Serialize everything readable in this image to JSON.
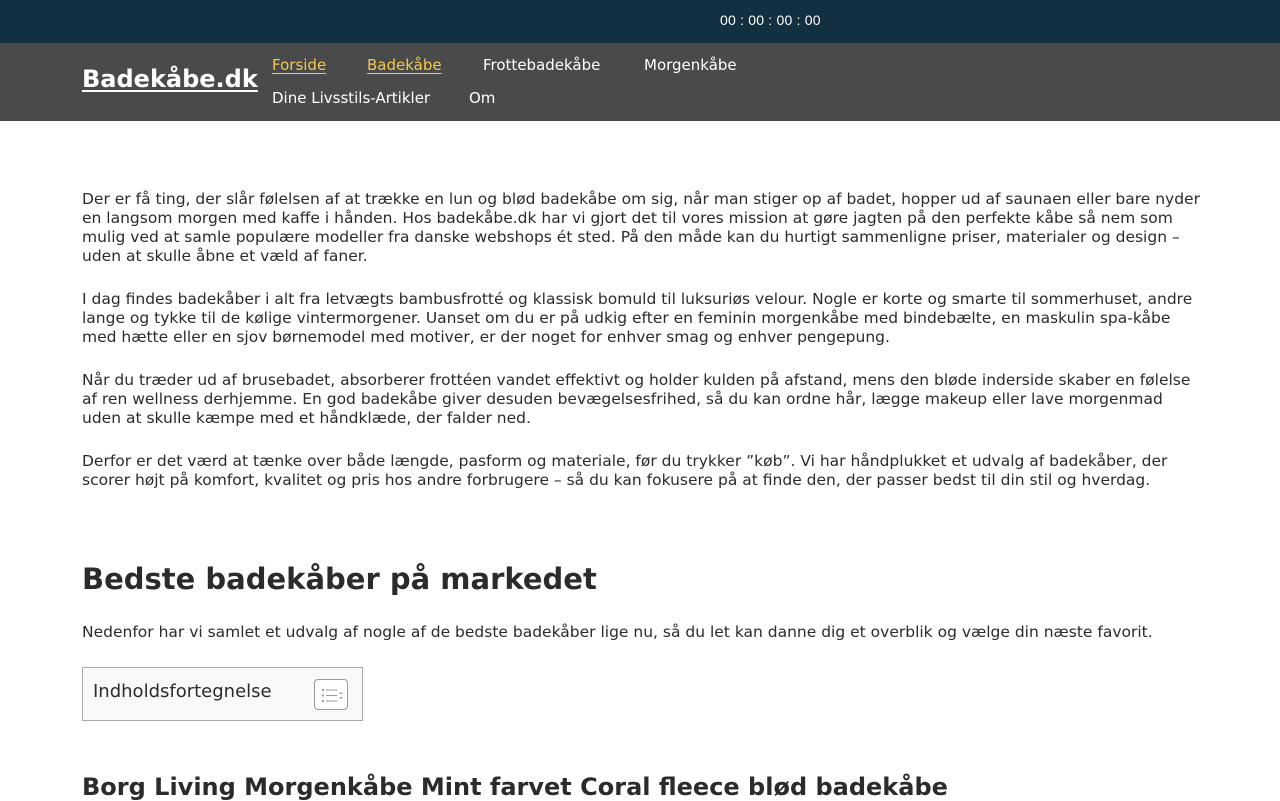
{
  "topbar": {
    "countdown": "00 : 00 : 00 : 00",
    "background": "#12303f"
  },
  "header": {
    "logo": "Badekåbe.dk",
    "background": "#4a4a4a",
    "accent": "#f2c94c",
    "nav": [
      {
        "label": "Forside",
        "active": true
      },
      {
        "label": "Badekåbe",
        "active": true
      },
      {
        "label": "Frottebadekåbe",
        "active": false
      },
      {
        "label": "Morgenkåbe",
        "active": false
      },
      {
        "label": "Dine Livsstils-Artikler",
        "active": false
      },
      {
        "label": "Om",
        "active": false
      }
    ]
  },
  "main": {
    "paragraphs": [
      "Der er få ting, der slår følelsen af at trække en lun og blød badekåbe om sig, når man stiger op af badet, hopper ud af saunaen eller bare nyder en langsom morgen med kaffe i hånden. Hos badekåbe.dk har vi gjort det til vores mission at gøre jagten på den perfekte kåbe så nem som mulig ved at samle populære modeller fra danske webshops ét sted. På den måde kan du hurtigt sammenligne priser, materialer og design – uden at skulle åbne et væld af faner.",
      "I dag findes badekåber i alt fra letvægts bambusfrotté og klassisk bomuld til luksuriøs velour. Nogle er korte og smarte til sommerhuset, andre lange og tykke til de kølige vintermorgener. Uanset om du er på udkig efter en feminin morgenkåbe med bindebælte, en maskulin spa-kåbe med hætte eller en sjov børnemodel med motiver, er der noget for enhver smag og enhver pengepung.",
      "Når du træder ud af brusebadet, absorberer frottéen vandet effektivt og holder kulden på afstand, mens den bløde inderside skaber en følelse af ren wellness derhjemme. En god badekåbe giver desuden bevægelsesfrihed, så du kan ordne hår, lægge makeup eller lave morgenmad uden at skulle kæmpe med et håndklæde, der falder ned.",
      "Derfor er det værd at tænke over både længde, pasform og materiale, før du trykker ”køb”. Vi har håndplukket et udvalg af badekåber, der scorer højt på komfort, kvalitet og pris hos andre forbrugere – så du kan fokusere på at finde den, der passer bedst til din stil og hverdag."
    ],
    "section_title": "Bedste badekåber på markedet",
    "section_intro": "Nedenfor har vi samlet et udvalg af nogle af de bedste badekåber lige nu, så du let kan danne dig et overblik og vælge din næste favorit.",
    "toc_title": "Indholdsfortegnelse",
    "product_title": "Borg Living Morgenkåbe Mint farvet Coral fleece blød badekåbe"
  }
}
